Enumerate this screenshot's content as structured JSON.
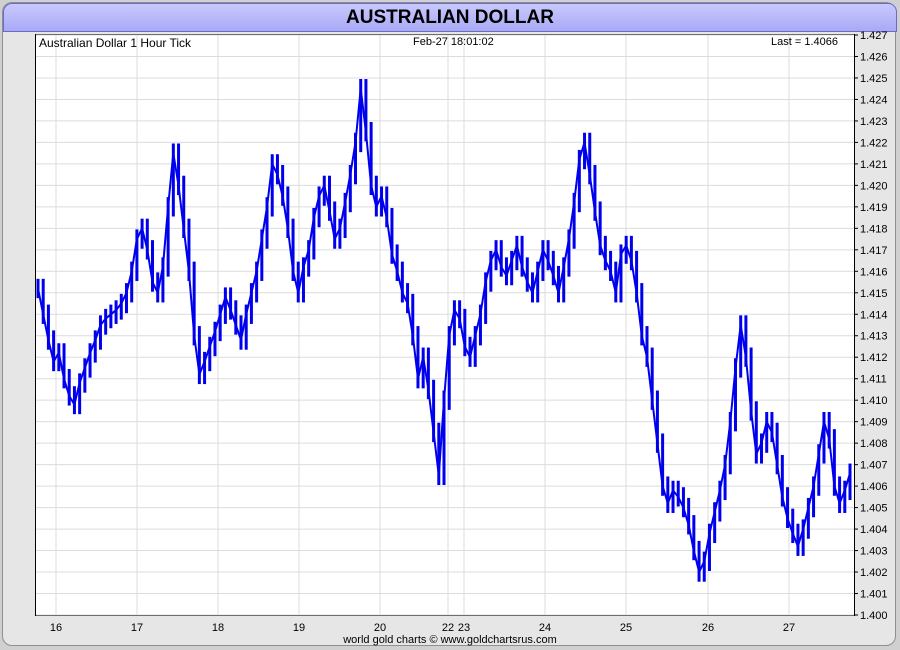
{
  "title": "AUSTRALIAN DOLLAR",
  "header": {
    "left": "Australian Dollar 1 Hour Tick",
    "center": "Feb-27  18:01:02",
    "right": "Last = 1.4066"
  },
  "footer": "world gold charts © www.goldchartsrus.com",
  "colors": {
    "line": "#0000ee",
    "grid": "#dcdcdc",
    "title_bg": "#b0b0f8"
  },
  "chart_data": {
    "type": "line",
    "title": "AUSTRALIAN DOLLAR",
    "ylim": [
      1.4,
      1.427
    ],
    "y_ticks": [
      "1.400",
      "1.401",
      "1.402",
      "1.403",
      "1.404",
      "1.405",
      "1.406",
      "1.407",
      "1.408",
      "1.409",
      "1.410",
      "1.411",
      "1.412",
      "1.413",
      "1.414",
      "1.415",
      "1.416",
      "1.417",
      "1.418",
      "1.419",
      "1.420",
      "1.421",
      "1.422",
      "1.423",
      "1.424",
      "1.425",
      "1.426",
      "1.427"
    ],
    "x_ticks": [
      "16",
      "17",
      "18",
      "19",
      "20",
      "22",
      "23",
      "24",
      "25",
      "26",
      "27"
    ],
    "grid": true,
    "series": [
      {
        "values": [
          1.4152,
          1.414,
          1.4128,
          1.4118,
          1.4122,
          1.411,
          1.4102,
          1.4098,
          1.4108,
          1.4115,
          1.4122,
          1.4128,
          1.4135,
          1.4138,
          1.414,
          1.4142,
          1.4145,
          1.415,
          1.416,
          1.4175,
          1.418,
          1.417,
          1.4155,
          1.415,
          1.4162,
          1.419,
          1.4215,
          1.42,
          1.418,
          1.416,
          1.413,
          1.4112,
          1.4118,
          1.4125,
          1.4132,
          1.414,
          1.4148,
          1.4142,
          1.4135,
          1.4128,
          1.414,
          1.415,
          1.416,
          1.4175,
          1.419,
          1.421,
          1.4205,
          1.4195,
          1.418,
          1.416,
          1.415,
          1.4162,
          1.417,
          1.4185,
          1.4195,
          1.42,
          1.4188,
          1.4175,
          1.418,
          1.4192,
          1.4205,
          1.422,
          1.4245,
          1.4225,
          1.42,
          1.419,
          1.4195,
          1.4185,
          1.4168,
          1.416,
          1.415,
          1.4145,
          1.413,
          1.411,
          1.412,
          1.4105,
          1.4085,
          1.4065,
          1.41,
          1.413,
          1.4142,
          1.4138,
          1.4125,
          1.412,
          1.413,
          1.414,
          1.4155,
          1.4165,
          1.417,
          1.4162,
          1.4158,
          1.4165,
          1.4172,
          1.4162,
          1.4155,
          1.415,
          1.416,
          1.417,
          1.4165,
          1.4158,
          1.415,
          1.4162,
          1.4175,
          1.4192,
          1.4212,
          1.422,
          1.4205,
          1.4188,
          1.4172,
          1.4165,
          1.416,
          1.415,
          1.4168,
          1.4172,
          1.4165,
          1.415,
          1.413,
          1.412,
          1.41,
          1.408,
          1.406,
          1.4052,
          1.4058,
          1.4055,
          1.405,
          1.4042,
          1.403,
          1.402,
          1.4025,
          1.4038,
          1.4048,
          1.4058,
          1.407,
          1.409,
          1.4115,
          1.4135,
          1.412,
          1.4095,
          1.4075,
          1.408,
          1.409,
          1.4085,
          1.407,
          1.4055,
          1.4045,
          1.4038,
          1.4032,
          1.404,
          1.405,
          1.406,
          1.4075,
          1.409,
          1.4082,
          1.406,
          1.4052,
          1.4058,
          1.4066
        ],
        "x_start": 15.75,
        "x_end": 27.7
      }
    ]
  }
}
